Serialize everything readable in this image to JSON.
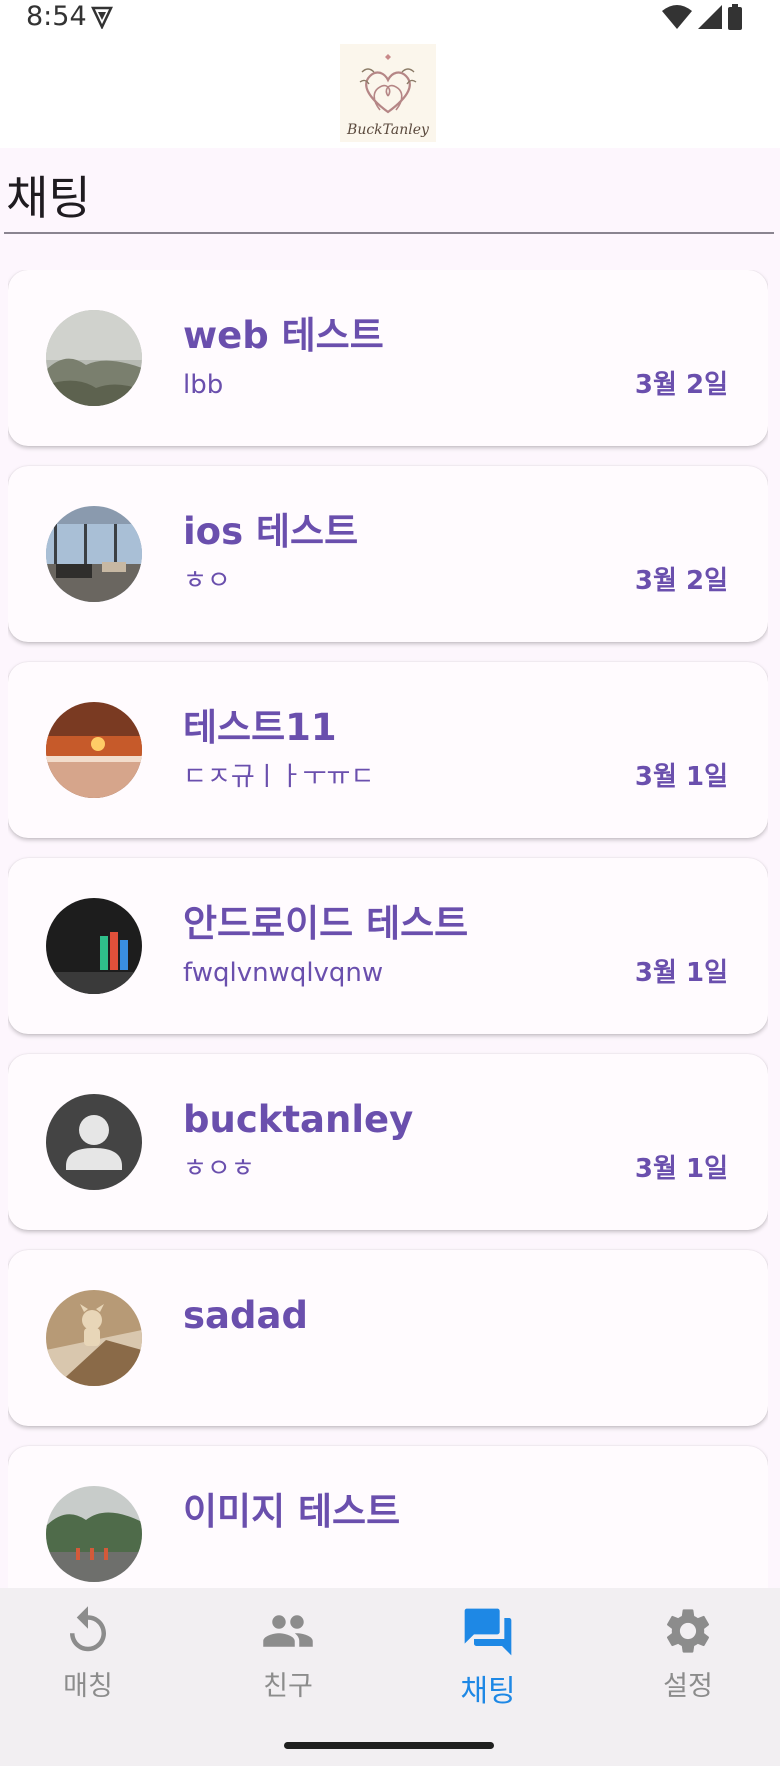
{
  "status_bar": {
    "time": "8:54"
  },
  "header": {
    "logo_text": "BuckTanley"
  },
  "page": {
    "title": "채팅"
  },
  "chats": [
    {
      "name": "web 테스트",
      "last_message": "lbb",
      "date": "3월 2일"
    },
    {
      "name": "ios 테스트",
      "last_message": "ㅎㅇ",
      "date": "3월 2일"
    },
    {
      "name": "테스트11",
      "last_message": "ㄷㅈ규ㅣㅏㅜㅠㄷ",
      "date": "3월 1일"
    },
    {
      "name": "안드로이드 테스트",
      "last_message": "fwqlvnwqlvqnw",
      "date": "3월 1일"
    },
    {
      "name": "bucktanley",
      "last_message": "ㅎㅇㅎ",
      "date": "3월 1일"
    },
    {
      "name": "sadad",
      "last_message": "",
      "date": ""
    },
    {
      "name": "이미지 테스트",
      "last_message": "",
      "date": ""
    }
  ],
  "bottom_nav": [
    {
      "label": "매칭",
      "icon": "refresh-icon",
      "active": false
    },
    {
      "label": "친구",
      "icon": "people-icon",
      "active": false
    },
    {
      "label": "채팅",
      "icon": "chat-icon",
      "active": true
    },
    {
      "label": "설정",
      "icon": "gear-icon",
      "active": false
    }
  ],
  "colors": {
    "accent_text": "#6a4fad",
    "active_tab": "#1e88e5",
    "inactive_tab": "#8c8c8c",
    "background": "#fdf6fd"
  }
}
